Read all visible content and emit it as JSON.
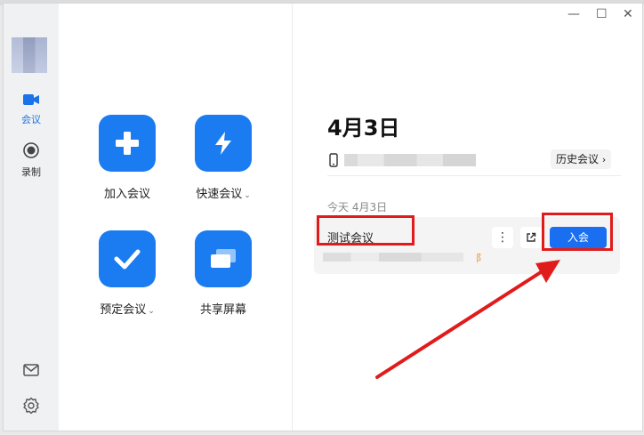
{
  "sidebar": {
    "items": [
      {
        "label": "会议",
        "icon": "video-camera-icon"
      },
      {
        "label": "录制",
        "icon": "record-icon"
      }
    ],
    "bottom_icons": [
      "mail-icon",
      "settings-gear-icon"
    ]
  },
  "actions": [
    {
      "label": "加入会议",
      "icon": "plus-icon",
      "dropdown": false
    },
    {
      "label": "快速会议",
      "icon": "lightning-icon",
      "dropdown": true
    },
    {
      "label": "预定会议",
      "icon": "checkmark-icon",
      "dropdown": true
    },
    {
      "label": "共享屏幕",
      "icon": "screen-share-icon",
      "dropdown": false
    }
  ],
  "main": {
    "date_title": "4月3日",
    "history_button": "历史会议",
    "today_label": "今天 4月3日",
    "meeting": {
      "name": "测试会议",
      "more_label": "⋮",
      "join_label": "入会",
      "partial_text": "阝"
    }
  },
  "colors": {
    "accent": "#1a7cf0",
    "annotation": "#e11b1b"
  }
}
